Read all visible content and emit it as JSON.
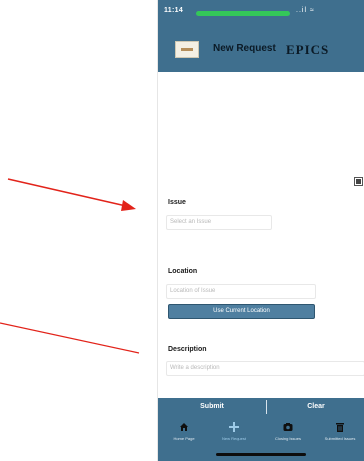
{
  "status_bar": {
    "time": "11:14",
    "indicators": "..il ≈"
  },
  "header": {
    "title": "New Request",
    "brand": "EPICS"
  },
  "form": {
    "issue": {
      "label": "Issue",
      "placeholder": "Select an Issue"
    },
    "location": {
      "label": "Location",
      "placeholder": "Location of Issue",
      "button_label": "Use Current Location"
    },
    "description": {
      "label": "Description",
      "placeholder": "Write a description"
    }
  },
  "actions": {
    "submit_label": "Submit",
    "clear_label": "Clear"
  },
  "tabs": [
    {
      "label": "Home Page",
      "icon": "home-icon",
      "active": false
    },
    {
      "label": "New Request",
      "icon": "plus-icon",
      "active": true
    },
    {
      "label": "Closing Issues",
      "icon": "camera-icon",
      "active": false
    },
    {
      "label": "Submitted Issues",
      "icon": "trash-icon",
      "active": false
    }
  ],
  "colors": {
    "header_bg": "#3f6f8e",
    "annotation_arrow": "#e2231a",
    "status_pill": "#34c759",
    "active_tab": "#9ecbe8"
  }
}
